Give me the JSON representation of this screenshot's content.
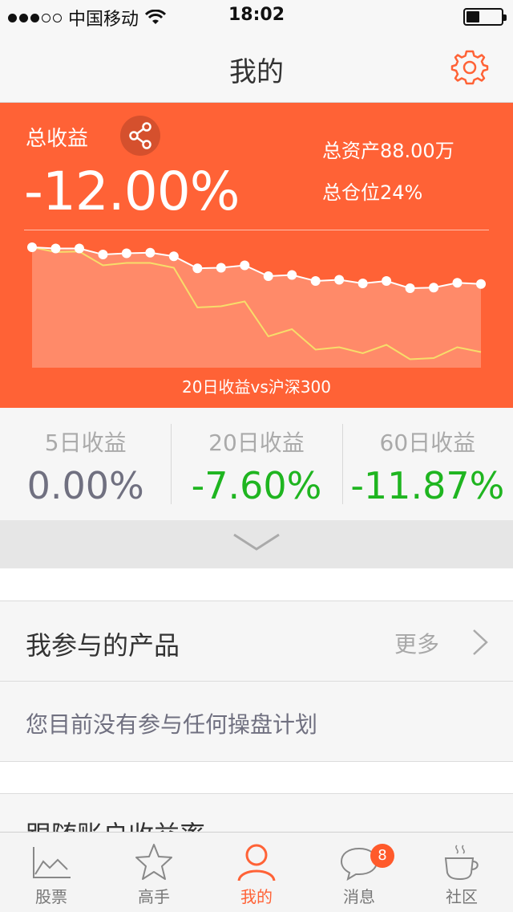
{
  "status_bar": {
    "carrier": "中国移动",
    "time": "18:02",
    "signal_bars_filled": 3,
    "signal_bars_total": 5
  },
  "nav": {
    "title": "我的",
    "settings_icon": "gear-icon"
  },
  "summary": {
    "total_label": "总收益",
    "total_value": "-12.00%",
    "assets": "总资产88.00万",
    "position": "总仓位24%",
    "share_icon": "share-icon"
  },
  "chart_data": {
    "type": "line",
    "caption": "20日收益vs沪深300",
    "series": [
      {
        "values": [
          0.0,
          -0.2,
          -0.2,
          -1.2,
          -1.0,
          -0.9,
          -1.5,
          -3.5,
          -3.4,
          -3.0,
          -4.8,
          -4.6,
          -5.6,
          -5.4,
          -6.0,
          -5.6,
          -6.8,
          -6.7,
          -5.9,
          -6.1
        ]
      },
      {
        "values": [
          0.0,
          -0.8,
          -0.7,
          -3.0,
          -2.6,
          -2.6,
          -3.4,
          -10.0,
          -9.8,
          -9.0,
          -14.8,
          -13.6,
          -17.0,
          -16.6,
          -17.6,
          -16.2,
          -18.6,
          -18.4,
          -16.6,
          -17.4
        ]
      }
    ],
    "colors": {
      "primary": "#ffffff",
      "benchmark": "#f7dd6a",
      "area": "#ff8a69"
    }
  },
  "stats": [
    {
      "label": "5日收益",
      "value": "0.00%",
      "tone": "neutral"
    },
    {
      "label": "20日收益",
      "value": "-7.60%",
      "tone": "negative"
    },
    {
      "label": "60日收益",
      "value": "-11.87%",
      "tone": "negative"
    }
  ],
  "products": {
    "title": "我参与的产品",
    "more": "更多",
    "empty_text": "您目前没有参与任何操盘计划"
  },
  "follow": {
    "title": "跟随账户收益率"
  },
  "tabs": [
    {
      "label": "股票",
      "icon": "chart-line-icon",
      "active": false
    },
    {
      "label": "高手",
      "icon": "star-icon",
      "active": false
    },
    {
      "label": "我的",
      "icon": "person-icon",
      "active": true
    },
    {
      "label": "消息",
      "icon": "chat-bubble-icon",
      "active": false,
      "badge": "8"
    },
    {
      "label": "社区",
      "icon": "coffee-cup-icon",
      "active": false
    }
  ],
  "colors": {
    "accent": "#ff6236",
    "negative": "#1fb520",
    "neutral": "#707080"
  }
}
